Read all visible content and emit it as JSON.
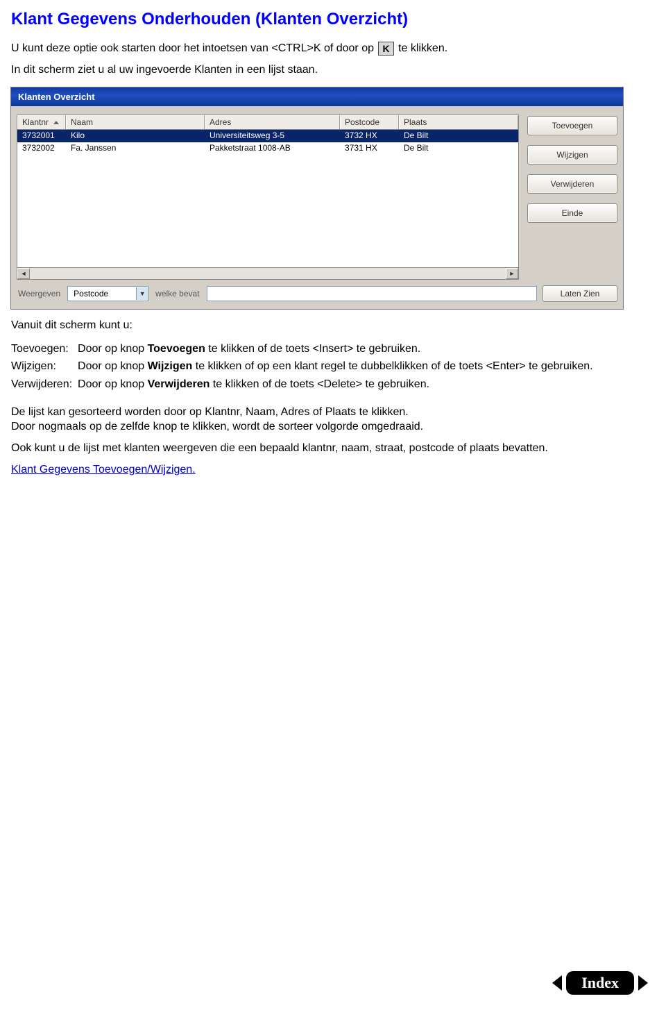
{
  "heading": "Klant Gegevens Onderhouden (Klanten Overzicht)",
  "intro1": {
    "pre": "U kunt deze optie ook starten door het intoetsen van <CTRL>K of door op",
    "badge": "K",
    "post": "te klikken."
  },
  "intro2": "In dit scherm ziet u al uw ingevoerde Klanten in een lijst staan.",
  "window": {
    "title": "Klanten Overzicht",
    "columns": {
      "klantnr": "Klantnr",
      "naam": "Naam",
      "adres": "Adres",
      "postcode": "Postcode",
      "plaats": "Plaats"
    },
    "rows": [
      {
        "klantnr": "3732001",
        "naam": "Kilo",
        "adres": "Universiteitsweg 3-5",
        "postcode": "3732 HX",
        "plaats": "De Bilt"
      },
      {
        "klantnr": "3732002",
        "naam": "Fa. Janssen",
        "adres": "Pakketstraat 1008-AB",
        "postcode": "3731 HX",
        "plaats": "De Bilt"
      }
    ],
    "buttons": {
      "toevoegen": "Toevoegen",
      "wijzigen": "Wijzigen",
      "verwijderen": "Verwijderen",
      "einde": "Einde",
      "laten_zien": "Laten Zien"
    },
    "filter": {
      "weergeven_label": "Weergeven",
      "combo_value": "Postcode",
      "welke_bevat_label": "welke bevat"
    }
  },
  "after_intro": "Vanuit dit scherm kunt u:",
  "actions": {
    "toevoegen": {
      "term": "Toevoegen:",
      "bold": "Toevoegen",
      "pre": "Door op knop ",
      "post": " te klikken of de toets <Insert> te gebruiken."
    },
    "wijzigen": {
      "term": "Wijzigen:",
      "bold": "Wijzigen",
      "pre": "Door op knop ",
      "post": " te klikken of op een klant regel te dubbelklikken of  de toets <Enter> te gebruiken."
    },
    "verwijderen": {
      "term": "Verwijderen:",
      "bold": "Verwijderen",
      "pre": "Door op knop ",
      "post": " te klikken of de toets <Delete> te gebruiken."
    }
  },
  "sort_p1": "De lijst kan gesorteerd worden door op Klantnr, Naam, Adres of Plaats te klikken.",
  "sort_p2": "Door nogmaals op de zelfde knop te klikken, wordt de sorteer volgorde omgedraaid.",
  "filter_p": "Ook kunt u de lijst met klanten weergeven die een bepaald klantnr, naam, straat, postcode of plaats bevatten.",
  "link_text": "Klant Gegevens Toevoegen/Wijzigen.",
  "footer": {
    "index": "Index"
  }
}
